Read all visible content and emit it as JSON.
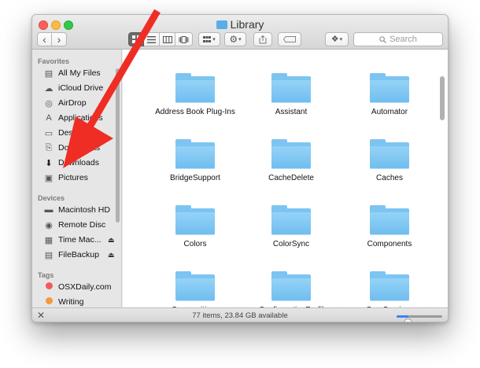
{
  "window": {
    "title": "Library",
    "back_glyph": "‹",
    "forward_glyph": "›"
  },
  "toolbar": {
    "search_placeholder": "Search",
    "view_modes": [
      "icon",
      "list",
      "column",
      "cover-flow"
    ]
  },
  "sidebar": {
    "favorites_header": "Favorites",
    "favorites": [
      {
        "label": "All My Files",
        "icon": "all-files-icon"
      },
      {
        "label": "iCloud Drive",
        "icon": "cloud-icon"
      },
      {
        "label": "AirDrop",
        "icon": "airdrop-icon"
      },
      {
        "label": "Applications",
        "icon": "applications-icon"
      },
      {
        "label": "Desktop",
        "icon": "desktop-icon"
      },
      {
        "label": "Documents",
        "icon": "documents-icon"
      },
      {
        "label": "Downloads",
        "icon": "downloads-icon"
      },
      {
        "label": "Pictures",
        "icon": "pictures-icon"
      }
    ],
    "devices_header": "Devices",
    "devices": [
      {
        "label": "Macintosh HD",
        "icon": "disk-icon"
      },
      {
        "label": "Remote Disc",
        "icon": "disc-icon"
      },
      {
        "label": "Time Mac...",
        "icon": "time-machine-icon",
        "eject": "⏏"
      },
      {
        "label": "FileBackup",
        "icon": "drive-icon",
        "eject": "⏏"
      }
    ],
    "tags_header": "Tags",
    "tags": [
      {
        "label": "OSXDaily.com",
        "color": "#f25a5a"
      },
      {
        "label": "Writing",
        "color": "#f29a3d"
      }
    ]
  },
  "folders": [
    {
      "name": "Address Book Plug-Ins"
    },
    {
      "name": "Assistant"
    },
    {
      "name": "Automator"
    },
    {
      "name": "BridgeSupport"
    },
    {
      "name": "CacheDelete"
    },
    {
      "name": "Caches"
    },
    {
      "name": "Colors"
    },
    {
      "name": "ColorSync"
    },
    {
      "name": "Components"
    },
    {
      "name": "Compositions"
    },
    {
      "name": "ConfigurationProfil"
    },
    {
      "name": "CoreServices"
    }
  ],
  "status": {
    "text": "77 items, 23.84 GB available",
    "icon_size_fraction": 0.25
  },
  "colors": {
    "folder_blue": "#7cc4f1",
    "annotation_red": "#ef2d24"
  }
}
